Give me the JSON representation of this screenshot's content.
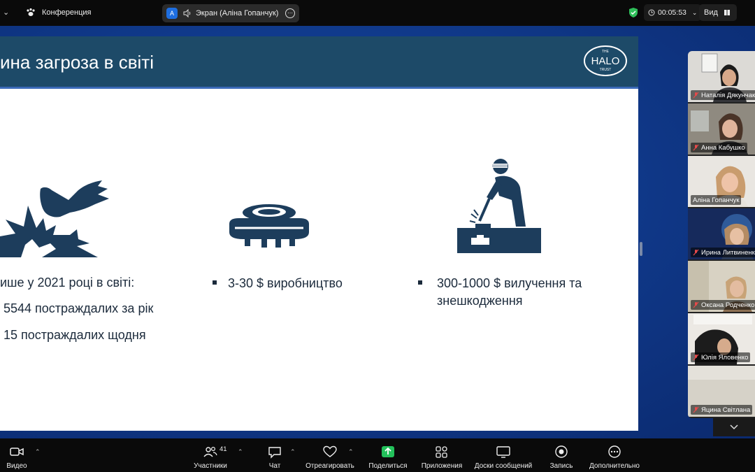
{
  "topbar": {
    "conference_label": "Конференция",
    "share_avatar_letter": "A",
    "share_label": "Экран (Аліна Гопанчук)",
    "timer": "00:05:53",
    "view_label": "Вид"
  },
  "slide": {
    "title": "ина загроза в світі",
    "logo_line1": "THE",
    "logo_main": "HALO",
    "logo_line2": "TRUST",
    "col1_heading": "ише у 2021 році в світі:",
    "col1_item1": "5544 постраждалих за рік",
    "col1_item2": "15 постраждалих щодня",
    "col2_item": "3-30 $ виробництво",
    "col3_line1": "300-1000 $ вилучення та",
    "col3_line2": "знешкодження"
  },
  "participants": [
    {
      "name": "Наталія Дякунчак",
      "active": false
    },
    {
      "name": "Анна Кабушко",
      "active": false
    },
    {
      "name": "Аліна Гопанчук",
      "active": true
    },
    {
      "name": "Ирина Литвиненко",
      "active": false
    },
    {
      "name": "Оксана Родченко",
      "active": false
    },
    {
      "name": "Юлія Яловенко",
      "active": false
    },
    {
      "name": "Яцина Світлана",
      "active": false
    }
  ],
  "toolbar": {
    "video": "Видео",
    "participants": "Участники",
    "participants_count": "41",
    "chat": "Чат",
    "react": "Отреагировать",
    "share": "Поделиться",
    "apps": "Приложения",
    "whiteboards": "Доски сообщений",
    "record": "Запись",
    "more": "Дополнительно"
  },
  "colors": {
    "slide_header": "#1d4a68",
    "slide_icon": "#1d3d5c",
    "share_green": "#2fd27a",
    "stage_blue": "#103a8c"
  }
}
